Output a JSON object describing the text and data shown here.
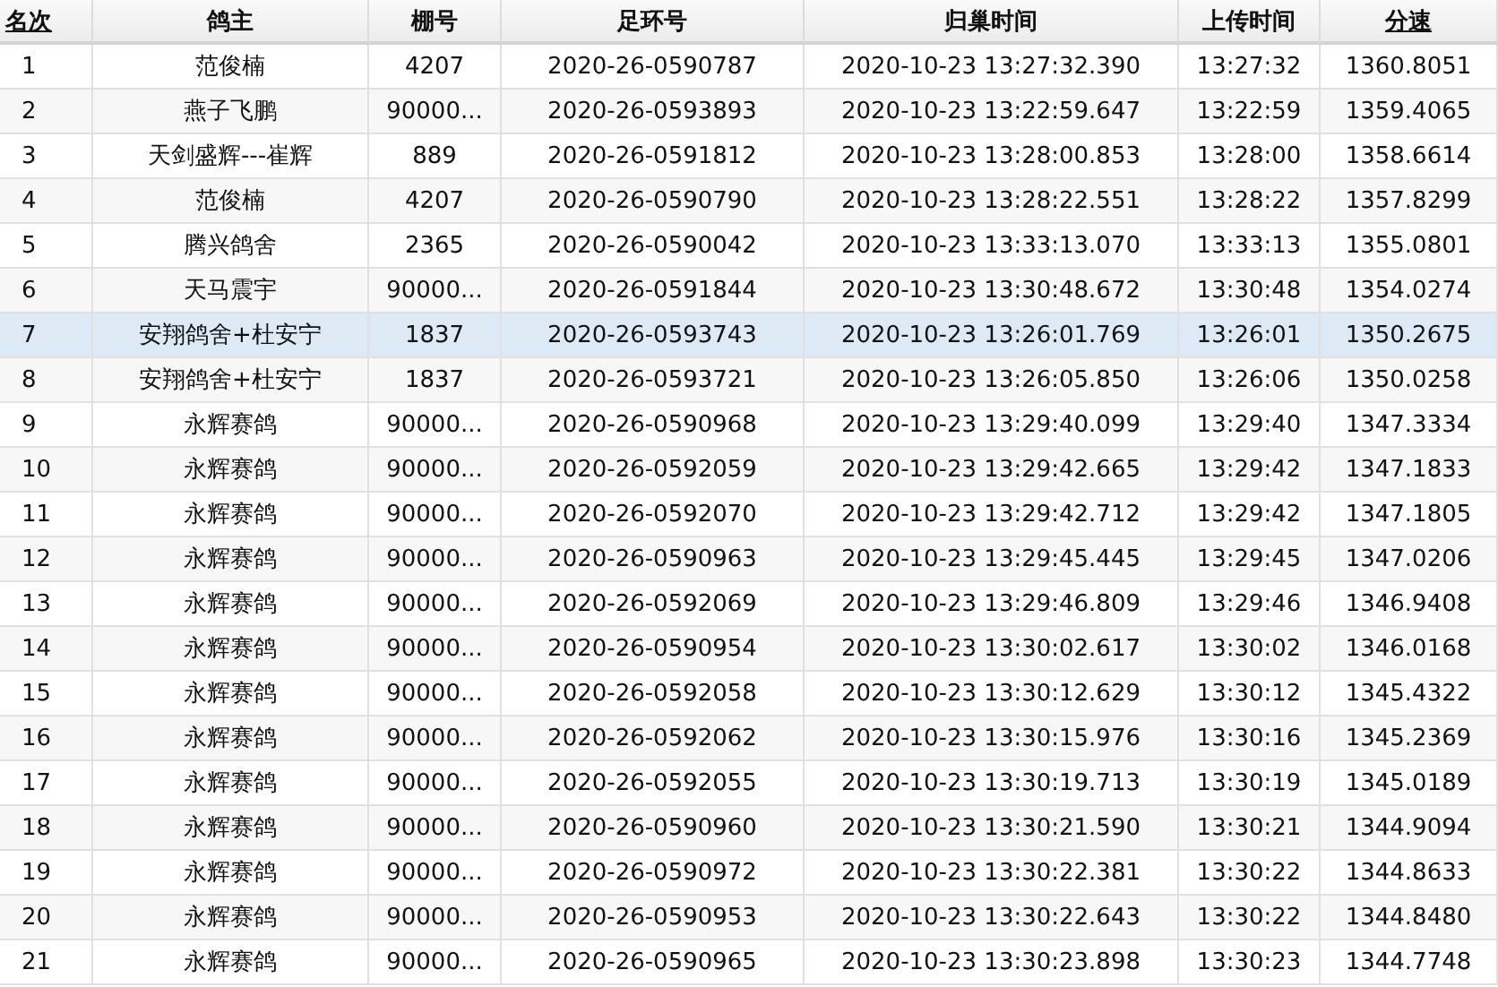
{
  "table": {
    "columns": [
      {
        "label": "名次",
        "sorted": true
      },
      {
        "label": "鸽主",
        "sorted": false
      },
      {
        "label": "棚号",
        "sorted": false
      },
      {
        "label": "足环号",
        "sorted": false
      },
      {
        "label": "归巢时间",
        "sorted": false
      },
      {
        "label": "上传时间",
        "sorted": false
      },
      {
        "label": "分速",
        "sorted": true
      }
    ],
    "rows": [
      {
        "selected": false,
        "cells": [
          "1",
          "范俊楠",
          "4207",
          "2020-26-0590787",
          "2020-10-23 13:27:32.390",
          "13:27:32",
          "1360.8051"
        ]
      },
      {
        "selected": false,
        "cells": [
          "2",
          "燕子飞鹏",
          "90000...",
          "2020-26-0593893",
          "2020-10-23 13:22:59.647",
          "13:22:59",
          "1359.4065"
        ]
      },
      {
        "selected": false,
        "cells": [
          "3",
          "天剑盛辉---崔辉",
          "889",
          "2020-26-0591812",
          "2020-10-23 13:28:00.853",
          "13:28:00",
          "1358.6614"
        ]
      },
      {
        "selected": false,
        "cells": [
          "4",
          "范俊楠",
          "4207",
          "2020-26-0590790",
          "2020-10-23 13:28:22.551",
          "13:28:22",
          "1357.8299"
        ]
      },
      {
        "selected": false,
        "cells": [
          "5",
          "腾兴鸽舍",
          "2365",
          "2020-26-0590042",
          "2020-10-23 13:33:13.070",
          "13:33:13",
          "1355.0801"
        ]
      },
      {
        "selected": false,
        "cells": [
          "6",
          "天马震宇",
          "90000...",
          "2020-26-0591844",
          "2020-10-23 13:30:48.672",
          "13:30:48",
          "1354.0274"
        ]
      },
      {
        "selected": true,
        "cells": [
          "7",
          "安翔鸽舍+杜安宁",
          "1837",
          "2020-26-0593743",
          "2020-10-23 13:26:01.769",
          "13:26:01",
          "1350.2675"
        ]
      },
      {
        "selected": false,
        "cells": [
          "8",
          "安翔鸽舍+杜安宁",
          "1837",
          "2020-26-0593721",
          "2020-10-23 13:26:05.850",
          "13:26:06",
          "1350.0258"
        ]
      },
      {
        "selected": false,
        "cells": [
          "9",
          "永辉赛鸽",
          "90000...",
          "2020-26-0590968",
          "2020-10-23 13:29:40.099",
          "13:29:40",
          "1347.3334"
        ]
      },
      {
        "selected": false,
        "cells": [
          "10",
          "永辉赛鸽",
          "90000...",
          "2020-26-0592059",
          "2020-10-23 13:29:42.665",
          "13:29:42",
          "1347.1833"
        ]
      },
      {
        "selected": false,
        "cells": [
          "11",
          "永辉赛鸽",
          "90000...",
          "2020-26-0592070",
          "2020-10-23 13:29:42.712",
          "13:29:42",
          "1347.1805"
        ]
      },
      {
        "selected": false,
        "cells": [
          "12",
          "永辉赛鸽",
          "90000...",
          "2020-26-0590963",
          "2020-10-23 13:29:45.445",
          "13:29:45",
          "1347.0206"
        ]
      },
      {
        "selected": false,
        "cells": [
          "13",
          "永辉赛鸽",
          "90000...",
          "2020-26-0592069",
          "2020-10-23 13:29:46.809",
          "13:29:46",
          "1346.9408"
        ]
      },
      {
        "selected": false,
        "cells": [
          "14",
          "永辉赛鸽",
          "90000...",
          "2020-26-0590954",
          "2020-10-23 13:30:02.617",
          "13:30:02",
          "1346.0168"
        ]
      },
      {
        "selected": false,
        "cells": [
          "15",
          "永辉赛鸽",
          "90000...",
          "2020-26-0592058",
          "2020-10-23 13:30:12.629",
          "13:30:12",
          "1345.4322"
        ]
      },
      {
        "selected": false,
        "cells": [
          "16",
          "永辉赛鸽",
          "90000...",
          "2020-26-0592062",
          "2020-10-23 13:30:15.976",
          "13:30:16",
          "1345.2369"
        ]
      },
      {
        "selected": false,
        "cells": [
          "17",
          "永辉赛鸽",
          "90000...",
          "2020-26-0592055",
          "2020-10-23 13:30:19.713",
          "13:30:19",
          "1345.0189"
        ]
      },
      {
        "selected": false,
        "cells": [
          "18",
          "永辉赛鸽",
          "90000...",
          "2020-26-0590960",
          "2020-10-23 13:30:21.590",
          "13:30:21",
          "1344.9094"
        ]
      },
      {
        "selected": false,
        "cells": [
          "19",
          "永辉赛鸽",
          "90000...",
          "2020-26-0590972",
          "2020-10-23 13:30:22.381",
          "13:30:22",
          "1344.8633"
        ]
      },
      {
        "selected": false,
        "cells": [
          "20",
          "永辉赛鸽",
          "90000...",
          "2020-26-0590953",
          "2020-10-23 13:30:22.643",
          "13:30:22",
          "1344.8480"
        ]
      },
      {
        "selected": false,
        "cells": [
          "21",
          "永辉赛鸽",
          "90000...",
          "2020-26-0590965",
          "2020-10-23 13:30:23.898",
          "13:30:23",
          "1344.7748"
        ]
      }
    ]
  }
}
